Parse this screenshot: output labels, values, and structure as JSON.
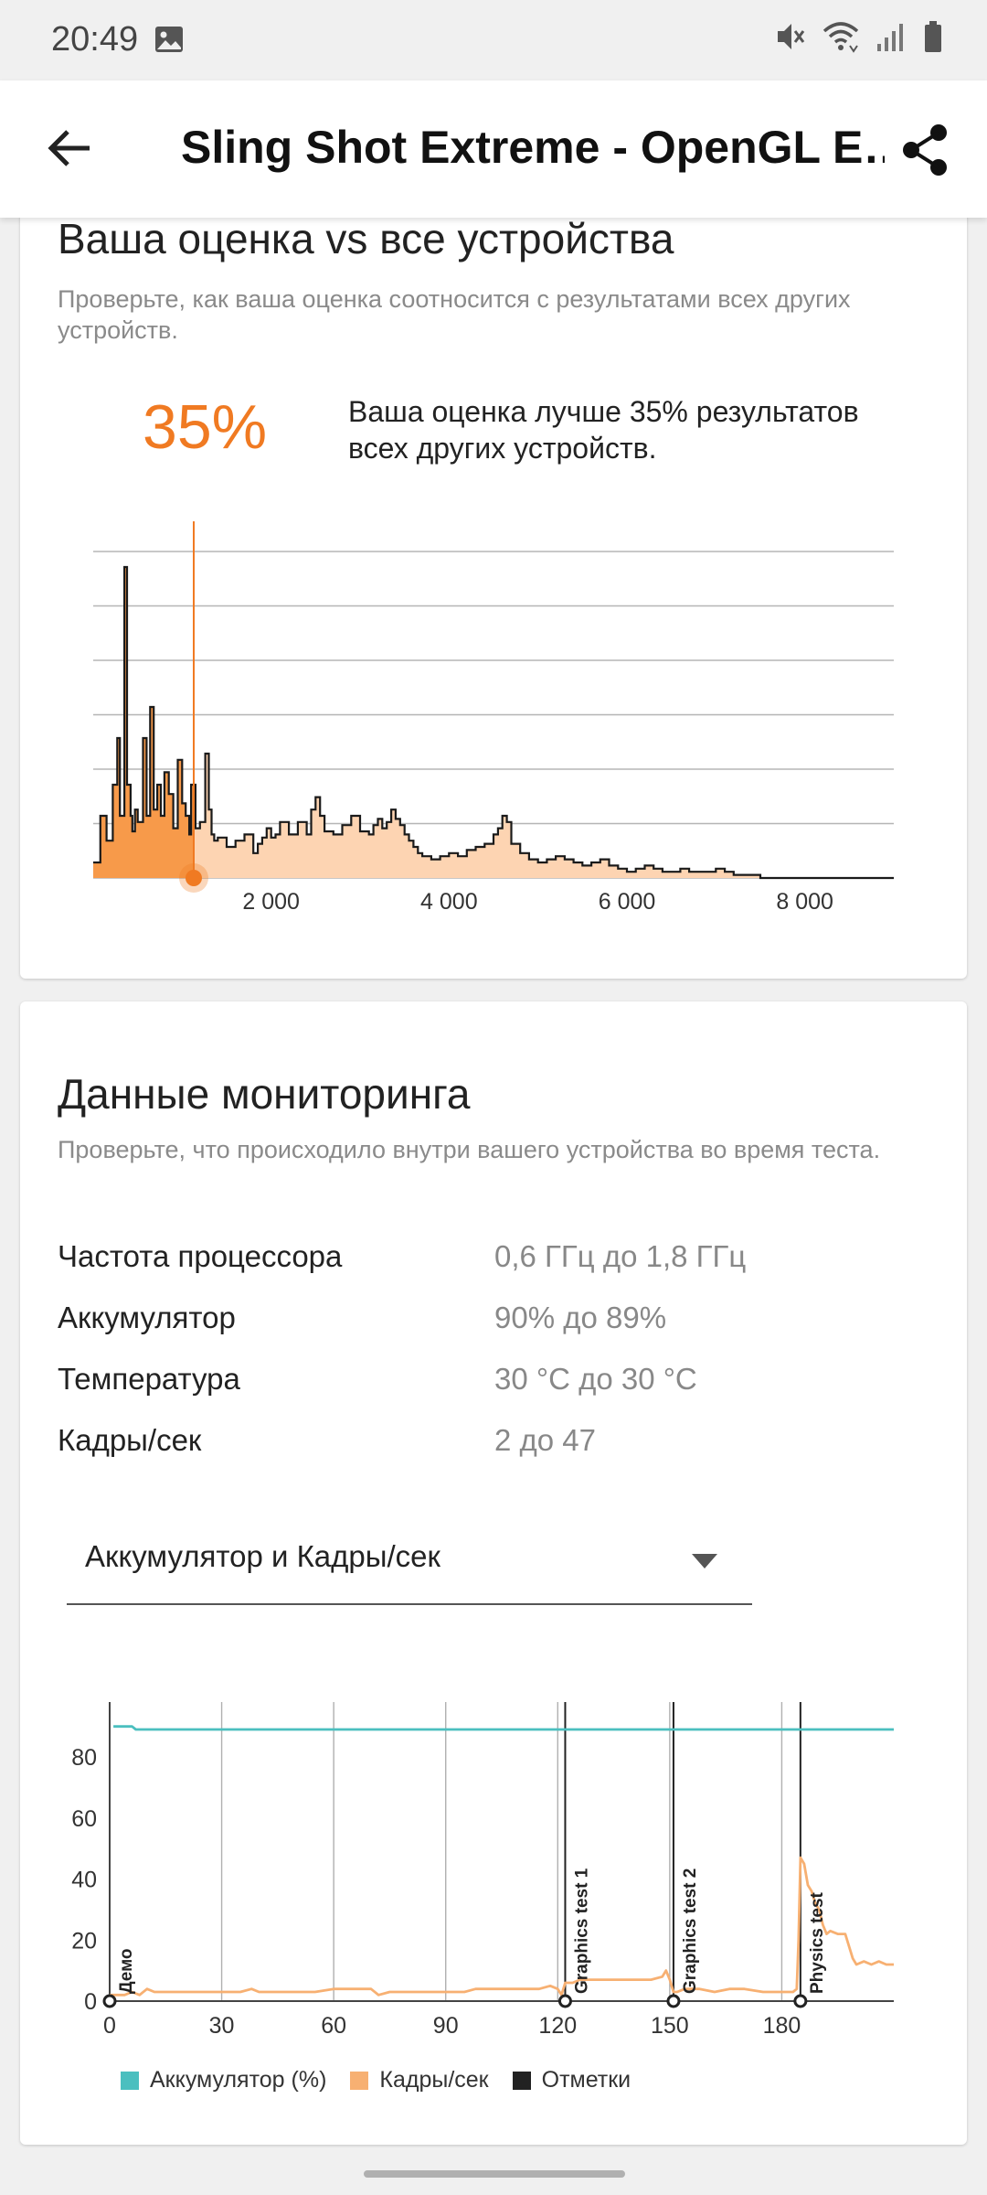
{
  "status": {
    "time": "20:49",
    "icons": [
      "image-icon",
      "mute-icon",
      "wifi-icon",
      "signal-icon",
      "battery-icon"
    ]
  },
  "appbar": {
    "title": "Sling Shot Extreme - OpenGL E…",
    "icons": [
      "back-arrow-icon",
      "share-icon"
    ]
  },
  "score_card": {
    "title": "Ваша оценка vs все устройства",
    "subtitle": "Проверьте, как ваша оценка соотносится с результатами всех других устройств.",
    "percentile": "35%",
    "percentile_text": "Ваша оценка лучше 35% результатов всех других устройств.",
    "accent_color": "#f07a22",
    "fill_color": "#fdd4b2"
  },
  "monitoring": {
    "title": "Данные мониторинга",
    "subtitle": "Проверьте, что происходило внутри вашего устройства во время теста.",
    "rows": [
      {
        "label": "Частота процессора",
        "value": "0,6 ГГц до 1,8 ГГц"
      },
      {
        "label": "Аккумулятор",
        "value": "90% до 89%"
      },
      {
        "label": "Температура",
        "value": "30 °C до 30 °C"
      },
      {
        "label": "Кадры/сек",
        "value": "2 до 47"
      }
    ],
    "dropdown": {
      "selected": "Аккумулятор и Кадры/сек"
    },
    "legend": [
      {
        "label": "Аккумулятор (%)",
        "color": "#4bbfbf"
      },
      {
        "label": "Кадры/сек",
        "color": "#f7b072"
      },
      {
        "label": "Отметки",
        "color": "#222222"
      }
    ]
  },
  "chart_data": [
    {
      "type": "area",
      "title": "",
      "x_ticks": [
        "2 000",
        "4 000",
        "6 000",
        "8 000"
      ],
      "x_tick_values": [
        2000,
        4000,
        6000,
        8000
      ],
      "xlim": [
        0,
        9000
      ],
      "ylim": [
        0,
        100
      ],
      "grid": true,
      "marker_value": 1130,
      "series": [
        {
          "x": [
            0,
            80,
            150,
            220,
            270,
            300,
            350,
            380,
            420,
            440,
            470,
            500,
            560,
            600,
            640,
            680,
            720,
            760,
            800,
            850,
            900,
            950,
            1000,
            1040,
            1080,
            1100,
            1150,
            1200,
            1260,
            1300,
            1330,
            1360,
            1400,
            1500,
            1600,
            1700,
            1800,
            1850,
            1900,
            1950,
            2000,
            2050,
            2100,
            2200,
            2300,
            2400,
            2450,
            2500,
            2550,
            2600,
            2700,
            2800,
            2900,
            3000,
            3100,
            3150,
            3200,
            3250,
            3300,
            3350,
            3400,
            3450,
            3500,
            3550,
            3600,
            3650,
            3700,
            3800,
            3900,
            4000,
            4100,
            4200,
            4300,
            4400,
            4500,
            4550,
            4600,
            4650,
            4700,
            4800,
            4900,
            5000,
            5100,
            5200,
            5300,
            5400,
            5500,
            5600,
            5700,
            5800,
            5900,
            6000,
            6100,
            6200,
            6300,
            6400,
            6500,
            6600,
            6700,
            6800,
            6900,
            7000,
            7100,
            7200,
            7300,
            7400,
            7500,
            8000,
            9000
          ],
          "y": [
            5,
            20,
            12,
            30,
            45,
            20,
            100,
            30,
            20,
            15,
            22,
            18,
            45,
            20,
            55,
            22,
            30,
            20,
            34,
            27,
            16,
            38,
            24,
            20,
            14,
            30,
            16,
            18,
            40,
            22,
            14,
            12,
            13,
            10,
            12,
            14,
            8,
            11,
            13,
            16,
            13,
            14,
            18,
            14,
            18,
            14,
            22,
            26,
            20,
            15,
            14,
            17,
            20,
            15,
            14,
            17,
            19,
            16,
            18,
            22,
            19,
            17,
            14,
            12,
            10,
            8,
            7,
            6,
            7,
            8,
            7,
            9,
            10,
            11,
            14,
            16,
            20,
            18,
            11,
            8,
            6,
            5,
            6,
            7,
            6,
            5,
            4,
            5,
            6,
            4,
            3,
            2,
            3,
            4,
            3,
            2,
            2,
            3,
            2,
            2,
            2,
            3,
            2,
            1,
            1,
            1,
            0,
            0,
            0
          ]
        }
      ]
    },
    {
      "type": "line",
      "title": "",
      "x_ticks": [
        "0",
        "30",
        "60",
        "90",
        "120",
        "150",
        "180"
      ],
      "y_ticks": [
        "0",
        "20",
        "40",
        "60",
        "80"
      ],
      "xlim": [
        0,
        210
      ],
      "ylim": [
        0,
        98
      ],
      "grid": true,
      "markers": [
        {
          "x": 0,
          "label": "Демо"
        },
        {
          "x": 122,
          "label": "Graphics test 1"
        },
        {
          "x": 151,
          "label": "Graphics test 2"
        },
        {
          "x": 185,
          "label": "Physics test"
        }
      ],
      "series": [
        {
          "name": "Аккумулятор (%)",
          "color": "#4bbfbf",
          "x": [
            1,
            6,
            7,
            210
          ],
          "y": [
            90,
            90,
            89,
            89
          ]
        },
        {
          "name": "Кадры/сек",
          "color": "#f7b072",
          "x": [
            0,
            4,
            6,
            8,
            10,
            12,
            15,
            20,
            25,
            30,
            35,
            38,
            40,
            45,
            50,
            55,
            60,
            65,
            70,
            72,
            75,
            80,
            85,
            90,
            95,
            98,
            100,
            105,
            110,
            115,
            118,
            120,
            121,
            122,
            124,
            126,
            130,
            135,
            140,
            145,
            148,
            149,
            150,
            151,
            152,
            154,
            158,
            162,
            166,
            170,
            175,
            180,
            183,
            184,
            184.5,
            185,
            186,
            187,
            188,
            189,
            190,
            191,
            192,
            193,
            195,
            197,
            199,
            200,
            202,
            204,
            206,
            208,
            210
          ],
          "y": [
            2,
            2,
            3,
            2,
            4,
            3,
            3,
            3,
            3,
            3,
            3,
            4,
            3,
            3,
            3,
            3,
            4,
            4,
            4,
            2,
            3,
            3,
            3,
            3,
            3,
            4,
            4,
            4,
            4,
            4,
            5,
            4,
            2,
            6,
            6,
            7,
            7,
            7,
            7,
            7,
            8,
            10,
            7,
            3,
            3,
            4,
            4,
            3,
            4,
            4,
            3,
            3,
            3,
            4,
            20,
            47,
            45,
            38,
            36,
            32,
            30,
            25,
            22,
            23,
            22,
            22,
            14,
            12,
            13,
            12,
            13,
            12,
            12
          ]
        }
      ]
    }
  ]
}
